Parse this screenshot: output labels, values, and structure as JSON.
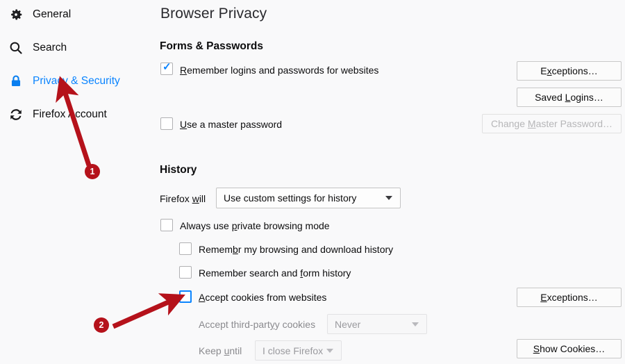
{
  "sidebar": {
    "items": [
      {
        "label": "General",
        "icon": "gear-icon",
        "selected": false
      },
      {
        "label": "Search",
        "icon": "search-icon",
        "selected": false
      },
      {
        "label": "Privacy & Security",
        "icon": "lock-icon",
        "selected": true
      },
      {
        "label": "Firefox Account",
        "icon": "sync-icon",
        "selected": false
      }
    ]
  },
  "main": {
    "page_title": "Browser Privacy",
    "sections": {
      "forms": {
        "heading": "Forms & Passwords",
        "remember_logins": {
          "label": "Remember logins and passwords for websites",
          "accesskey": "R",
          "checked": true
        },
        "master_password": {
          "label": "Use a master password",
          "accesskey": "U",
          "checked": false
        },
        "exceptions_button": {
          "label": "Exceptions…",
          "accesskey": "x",
          "disabled": false
        },
        "saved_logins_button": {
          "label": "Saved Logins…",
          "accesskey": "L",
          "disabled": false
        },
        "change_master_password_button": {
          "label": "Change Master Password…",
          "accesskey": "M",
          "disabled": true
        }
      },
      "history": {
        "heading": "History",
        "firefox_will_label": "Firefox will",
        "firefox_will_accesskey": "w",
        "mode_select": {
          "value": "Use custom settings for history",
          "disabled": false
        },
        "always_private": {
          "label": "Always use private browsing mode",
          "accesskey": "p",
          "checked": false
        },
        "remember_browsing": {
          "label": "Remember my browsing and download history",
          "accesskey": "b",
          "checked": false
        },
        "remember_search_form": {
          "label": "Remember search and form history",
          "accesskey": "f",
          "checked": false
        },
        "accept_cookies": {
          "label": "Accept cookies from websites",
          "accesskey": "A",
          "checked": false,
          "focused": true
        },
        "third_party_label": "Accept third-party cookies",
        "third_party_accesskey": "y",
        "third_party_select": {
          "value": "Never",
          "disabled": true
        },
        "keep_until_label": "Keep until",
        "keep_until_accesskey": "u",
        "keep_until_select": {
          "value": "I close Firefox",
          "disabled": true
        },
        "cookie_exceptions_button": {
          "label": "Exceptions…",
          "accesskey": "E",
          "disabled": false
        },
        "show_cookies_button": {
          "label": "Show Cookies…",
          "accesskey": "S",
          "disabled": false
        }
      }
    }
  },
  "annotations": {
    "markers": [
      {
        "number": "1",
        "target": "privacy-and-security-nav-item"
      },
      {
        "number": "2",
        "target": "accept-cookies-checkbox"
      }
    ],
    "color": "#b5121b"
  }
}
